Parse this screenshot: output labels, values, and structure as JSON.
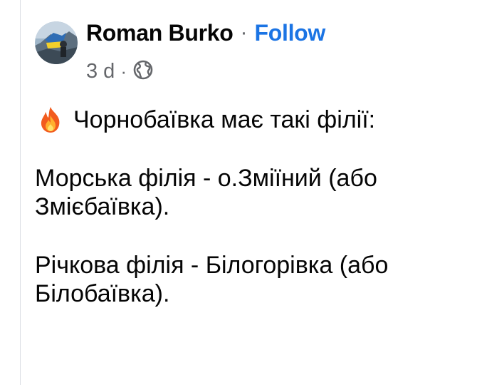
{
  "post": {
    "author": "Roman Burko",
    "separator": "·",
    "follow_label": "Follow",
    "time": "3 d",
    "meta_separator": "·",
    "privacy_icon": "globe-icon",
    "paragraphs": [
      "Чорнобаївка має такі філії:",
      "Морська філія - о.Зміїний (або Змієбаївка).",
      "Річкова філія - Білогорівка (або Білобаївка)."
    ],
    "lead_icon": "fire-icon"
  },
  "colors": {
    "follow": "#1b74e4",
    "meta": "#65676b",
    "text": "#050505"
  }
}
